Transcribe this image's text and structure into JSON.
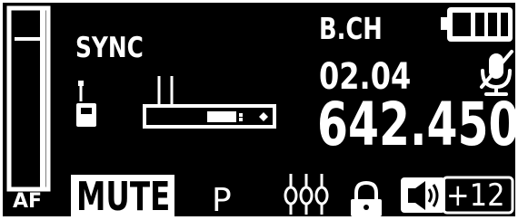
{
  "status": {
    "sync_label": "SYNC",
    "af_label": "AF",
    "mute_label": "MUTE",
    "program_label": "P"
  },
  "channel": {
    "bank_channel_label": "B.CH",
    "bank_channel_value": "02.04",
    "frequency": "642.450"
  },
  "audio": {
    "gain": "+12"
  },
  "meter": {
    "af_level": 0.0
  },
  "battery": {
    "bars_filled": 3,
    "bars_total": 3
  },
  "icons": {
    "transmitter": "bodypack-transmitter-icon",
    "receiver": "receiver-icon",
    "mic_muted": "mic-muted-icon",
    "eq": "eq-sliders-icon",
    "lock": "lock-icon",
    "speaker": "speaker-icon",
    "battery": "battery-icon"
  },
  "colors": {
    "background": "#000000",
    "foreground": "#ffffff"
  }
}
